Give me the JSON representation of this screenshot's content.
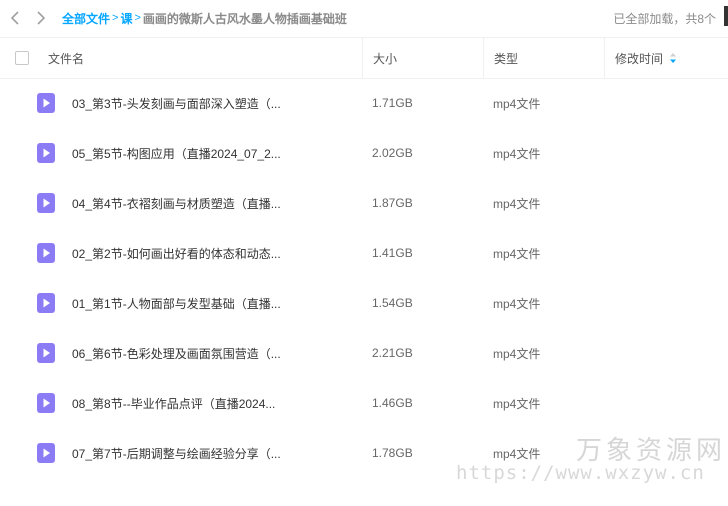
{
  "breadcrumb": {
    "root": "全部文件",
    "level1": "课",
    "current": "画画的微斯人古风水墨人物插画基础班"
  },
  "status": {
    "loaded_text": "已全部加载，共8个"
  },
  "table": {
    "columns": {
      "name": "文件名",
      "size": "大小",
      "type": "类型",
      "modified": "修改时间"
    },
    "rows": [
      {
        "name": "03_第3节-头发刻画与面部深入塑造（...",
        "size": "1.71GB",
        "type": "mp4文件"
      },
      {
        "name": "05_第5节-构图应用（直播2024_07_2...",
        "size": "2.02GB",
        "type": "mp4文件"
      },
      {
        "name": "04_第4节-衣褶刻画与材质塑造（直播...",
        "size": "1.87GB",
        "type": "mp4文件"
      },
      {
        "name": "02_第2节-如何画出好看的体态和动态...",
        "size": "1.41GB",
        "type": "mp4文件"
      },
      {
        "name": "01_第1节-人物面部与发型基础（直播...",
        "size": "1.54GB",
        "type": "mp4文件"
      },
      {
        "name": "06_第6节-色彩处理及画面氛围营造（...",
        "size": "2.21GB",
        "type": "mp4文件"
      },
      {
        "name": "08_第8节--毕业作品点评（直播2024...",
        "size": "1.46GB",
        "type": "mp4文件"
      },
      {
        "name": "07_第7节-后期调整与绘画经验分享（...",
        "size": "1.78GB",
        "type": "mp4文件"
      }
    ]
  },
  "watermark": {
    "cn": "万象资源网",
    "url": "https://www.wxzyw.cn"
  },
  "colors": {
    "accent": "#06a7ff",
    "video_icon": "#8b7cf6"
  },
  "icons": {
    "back": "chevron-left-icon",
    "forward": "chevron-right-icon",
    "sort": "sort-icon",
    "file": "video-file-icon"
  }
}
